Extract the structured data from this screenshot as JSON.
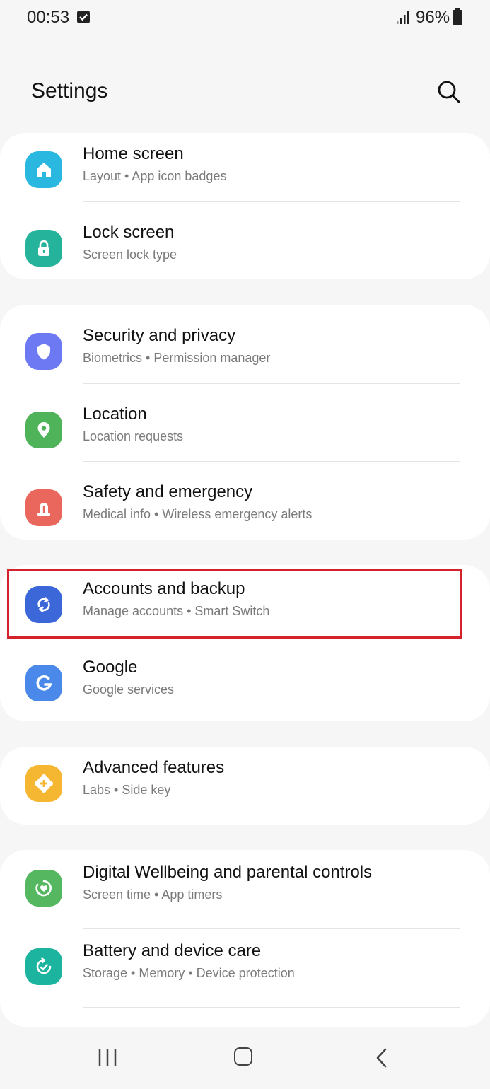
{
  "status": {
    "time": "00:53",
    "battery": "96%"
  },
  "header": {
    "title": "Settings"
  },
  "items": [
    {
      "title": "Home screen",
      "subtitle": "Layout  •  App icon badges",
      "icon": "home-icon",
      "color": "#2ab8e0"
    },
    {
      "title": "Lock screen",
      "subtitle": "Screen lock type",
      "icon": "lock-icon",
      "color": "#26b39b"
    },
    {
      "title": "Security and privacy",
      "subtitle": "Biometrics  •  Permission manager",
      "icon": "shield-icon",
      "color": "#6d79f2"
    },
    {
      "title": "Location",
      "subtitle": "Location requests",
      "icon": "location-pin-icon",
      "color": "#4fb35a"
    },
    {
      "title": "Safety and emergency",
      "subtitle": "Medical info  •  Wireless emergency alerts",
      "icon": "alert-icon",
      "color": "#e9675d"
    },
    {
      "title": "Accounts and backup",
      "subtitle": "Manage accounts  •  Smart Switch",
      "icon": "sync-icon",
      "color": "#3b67d8"
    },
    {
      "title": "Google",
      "subtitle": "Google services",
      "icon": "google-g-icon",
      "color": "#4a89ea"
    },
    {
      "title": "Advanced features",
      "subtitle": "Labs  •  Side key",
      "icon": "puzzle-plus-icon",
      "color": "#f5b631"
    },
    {
      "title": "Digital Wellbeing and parental controls",
      "subtitle": "Screen time  •  App timers",
      "icon": "wellbeing-icon",
      "color": "#55b860"
    },
    {
      "title": "Battery and device care",
      "subtitle": "Storage  •  Memory  •  Device protection",
      "icon": "device-care-icon",
      "color": "#1cb49e"
    }
  ]
}
